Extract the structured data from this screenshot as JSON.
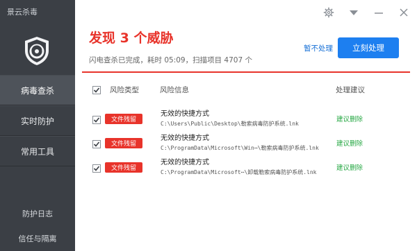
{
  "app": {
    "title": "景云杀毒"
  },
  "sidebar": {
    "items": [
      {
        "label": "病毒查杀",
        "active": true
      },
      {
        "label": "实时防护",
        "active": false
      },
      {
        "label": "常用工具",
        "active": false
      }
    ],
    "bottom": [
      {
        "label": "防护日志"
      },
      {
        "label": "信任与隔离"
      }
    ]
  },
  "window_controls": [
    "settings-gear-icon",
    "dropdown-arrow-icon",
    "minimize-icon",
    "close-icon"
  ],
  "header": {
    "title": "发现 3 个威胁",
    "summary": "闪电查杀已完成，耗时 05:09，扫描项目 4707 个",
    "ignore_label": "暂不处理",
    "fix_label": "立刻处理"
  },
  "table": {
    "columns": {
      "type": "风险类型",
      "info": "风险信息",
      "advice": "处理建议"
    },
    "rows": [
      {
        "type": "文件残留",
        "name": "无效的快捷方式",
        "path": "C:\\Users\\Public\\Desktop\\勒索病毒防护系统.lnk",
        "advice": "建议删除",
        "checked": true
      },
      {
        "type": "文件残留",
        "name": "无效的快捷方式",
        "path": "C:\\ProgramData\\Microsoft\\Win⋯\\勒索病毒防护系统.lnk",
        "advice": "建议删除",
        "checked": true
      },
      {
        "type": "文件残留",
        "name": "无效的快捷方式",
        "path": "C:\\ProgramData\\Microsoft⋯\\卸载勒索病毒防护系统.lnk",
        "advice": "建议删除",
        "checked": true
      }
    ]
  },
  "colors": {
    "accent_red": "#e8332a",
    "accent_blue": "#1d7ff0",
    "advice_green": "#27a844",
    "sidebar": "#3b3f45"
  }
}
